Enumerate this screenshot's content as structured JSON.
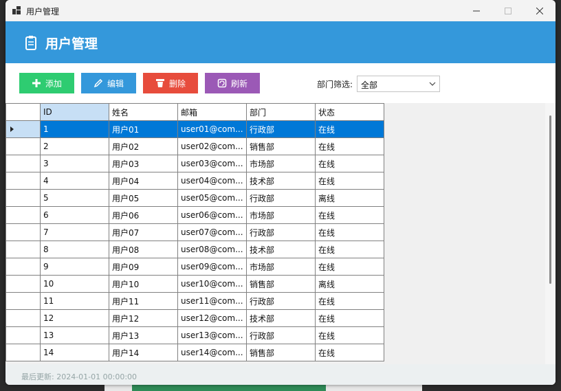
{
  "window": {
    "title": "用户管理"
  },
  "header": {
    "title": "用户管理"
  },
  "toolbar": {
    "add_label": "添加",
    "edit_label": "编辑",
    "delete_label": "删除",
    "refresh_label": "刷新",
    "filter_label": "部门筛选:",
    "filter_value": "全部"
  },
  "colors": {
    "add": "#2ecc71",
    "edit": "#3498db",
    "delete": "#e74c3c",
    "refresh": "#9b59b6",
    "header": "#3498db",
    "selected_row": "#0078d7"
  },
  "grid": {
    "columns": [
      "ID",
      "姓名",
      "邮箱",
      "部门",
      "状态"
    ],
    "rows": [
      [
        "1",
        "用户01",
        "user01@com...",
        "行政部",
        "在线"
      ],
      [
        "2",
        "用户02",
        "user02@com...",
        "销售部",
        "在线"
      ],
      [
        "3",
        "用户03",
        "user03@com...",
        "市场部",
        "在线"
      ],
      [
        "4",
        "用户04",
        "user04@com...",
        "技术部",
        "在线"
      ],
      [
        "5",
        "用户05",
        "user05@com...",
        "行政部",
        "离线"
      ],
      [
        "6",
        "用户06",
        "user06@com...",
        "市场部",
        "在线"
      ],
      [
        "7",
        "用户07",
        "user07@com...",
        "行政部",
        "在线"
      ],
      [
        "8",
        "用户08",
        "user08@com...",
        "技术部",
        "在线"
      ],
      [
        "9",
        "用户09",
        "user09@com...",
        "市场部",
        "在线"
      ],
      [
        "10",
        "用户10",
        "user10@com...",
        "销售部",
        "离线"
      ],
      [
        "11",
        "用户11",
        "user11@com...",
        "行政部",
        "在线"
      ],
      [
        "12",
        "用户12",
        "user12@com...",
        "技术部",
        "在线"
      ],
      [
        "13",
        "用户13",
        "user13@com...",
        "行政部",
        "在线"
      ],
      [
        "14",
        "用户14",
        "user14@com...",
        "销售部",
        "在线"
      ]
    ]
  },
  "status": {
    "text": "最后更新: 2024-01-01 00:00:00"
  }
}
